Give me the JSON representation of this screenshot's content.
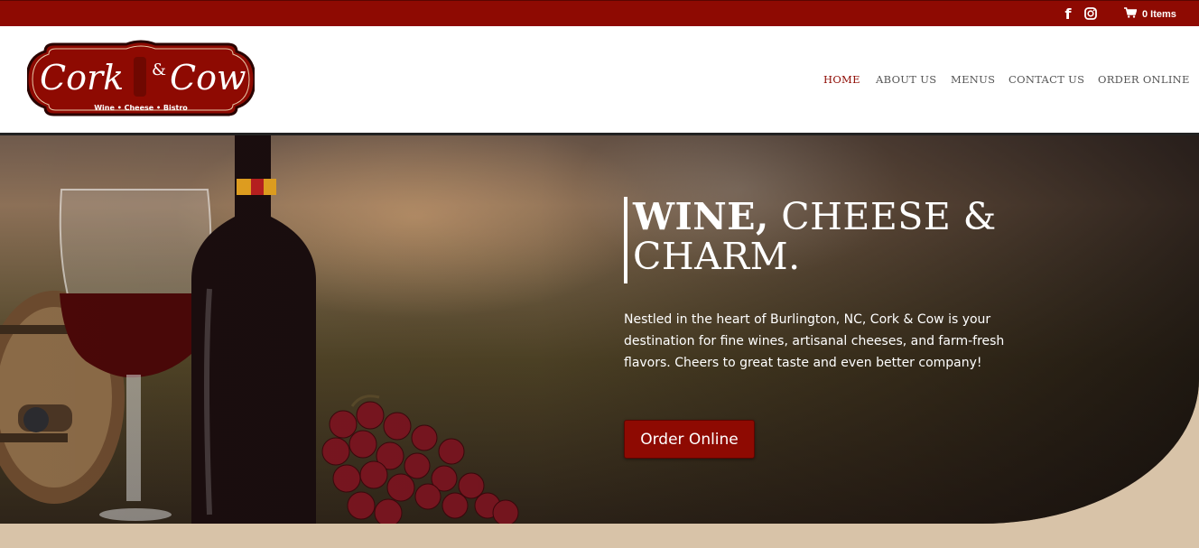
{
  "topbar": {
    "facebook_icon": "facebook-icon",
    "instagram_icon": "instagram-icon",
    "cart_icon": "cart-icon",
    "cart_label": "0 Items",
    "color": "#8e0a02"
  },
  "logo": {
    "name_left": "Cork",
    "ampersand": "&",
    "name_right": "Cow",
    "tagline": "Wine • Cheese • Bistro"
  },
  "nav": {
    "items": [
      {
        "label": "HOME",
        "active": true
      },
      {
        "label": "ABOUT US",
        "active": false
      },
      {
        "label": "MENUS",
        "active": false
      },
      {
        "label": "CONTACT US",
        "active": false
      },
      {
        "label": "ORDER ONLINE",
        "active": false
      }
    ]
  },
  "hero": {
    "headline_bold": "WINE,",
    "headline_rest": " CHEESE &",
    "headline_line2": "CHARM.",
    "description": "Nestled in the heart of Burlington, NC, Cork & Cow is your destination for fine wines, artisanal cheeses, and farm-fresh flavors. Cheers to great taste and even better company!",
    "button_label": "Order Online"
  },
  "colors": {
    "brand": "#8e0a02",
    "accent_bg": "#d8c3a8"
  }
}
